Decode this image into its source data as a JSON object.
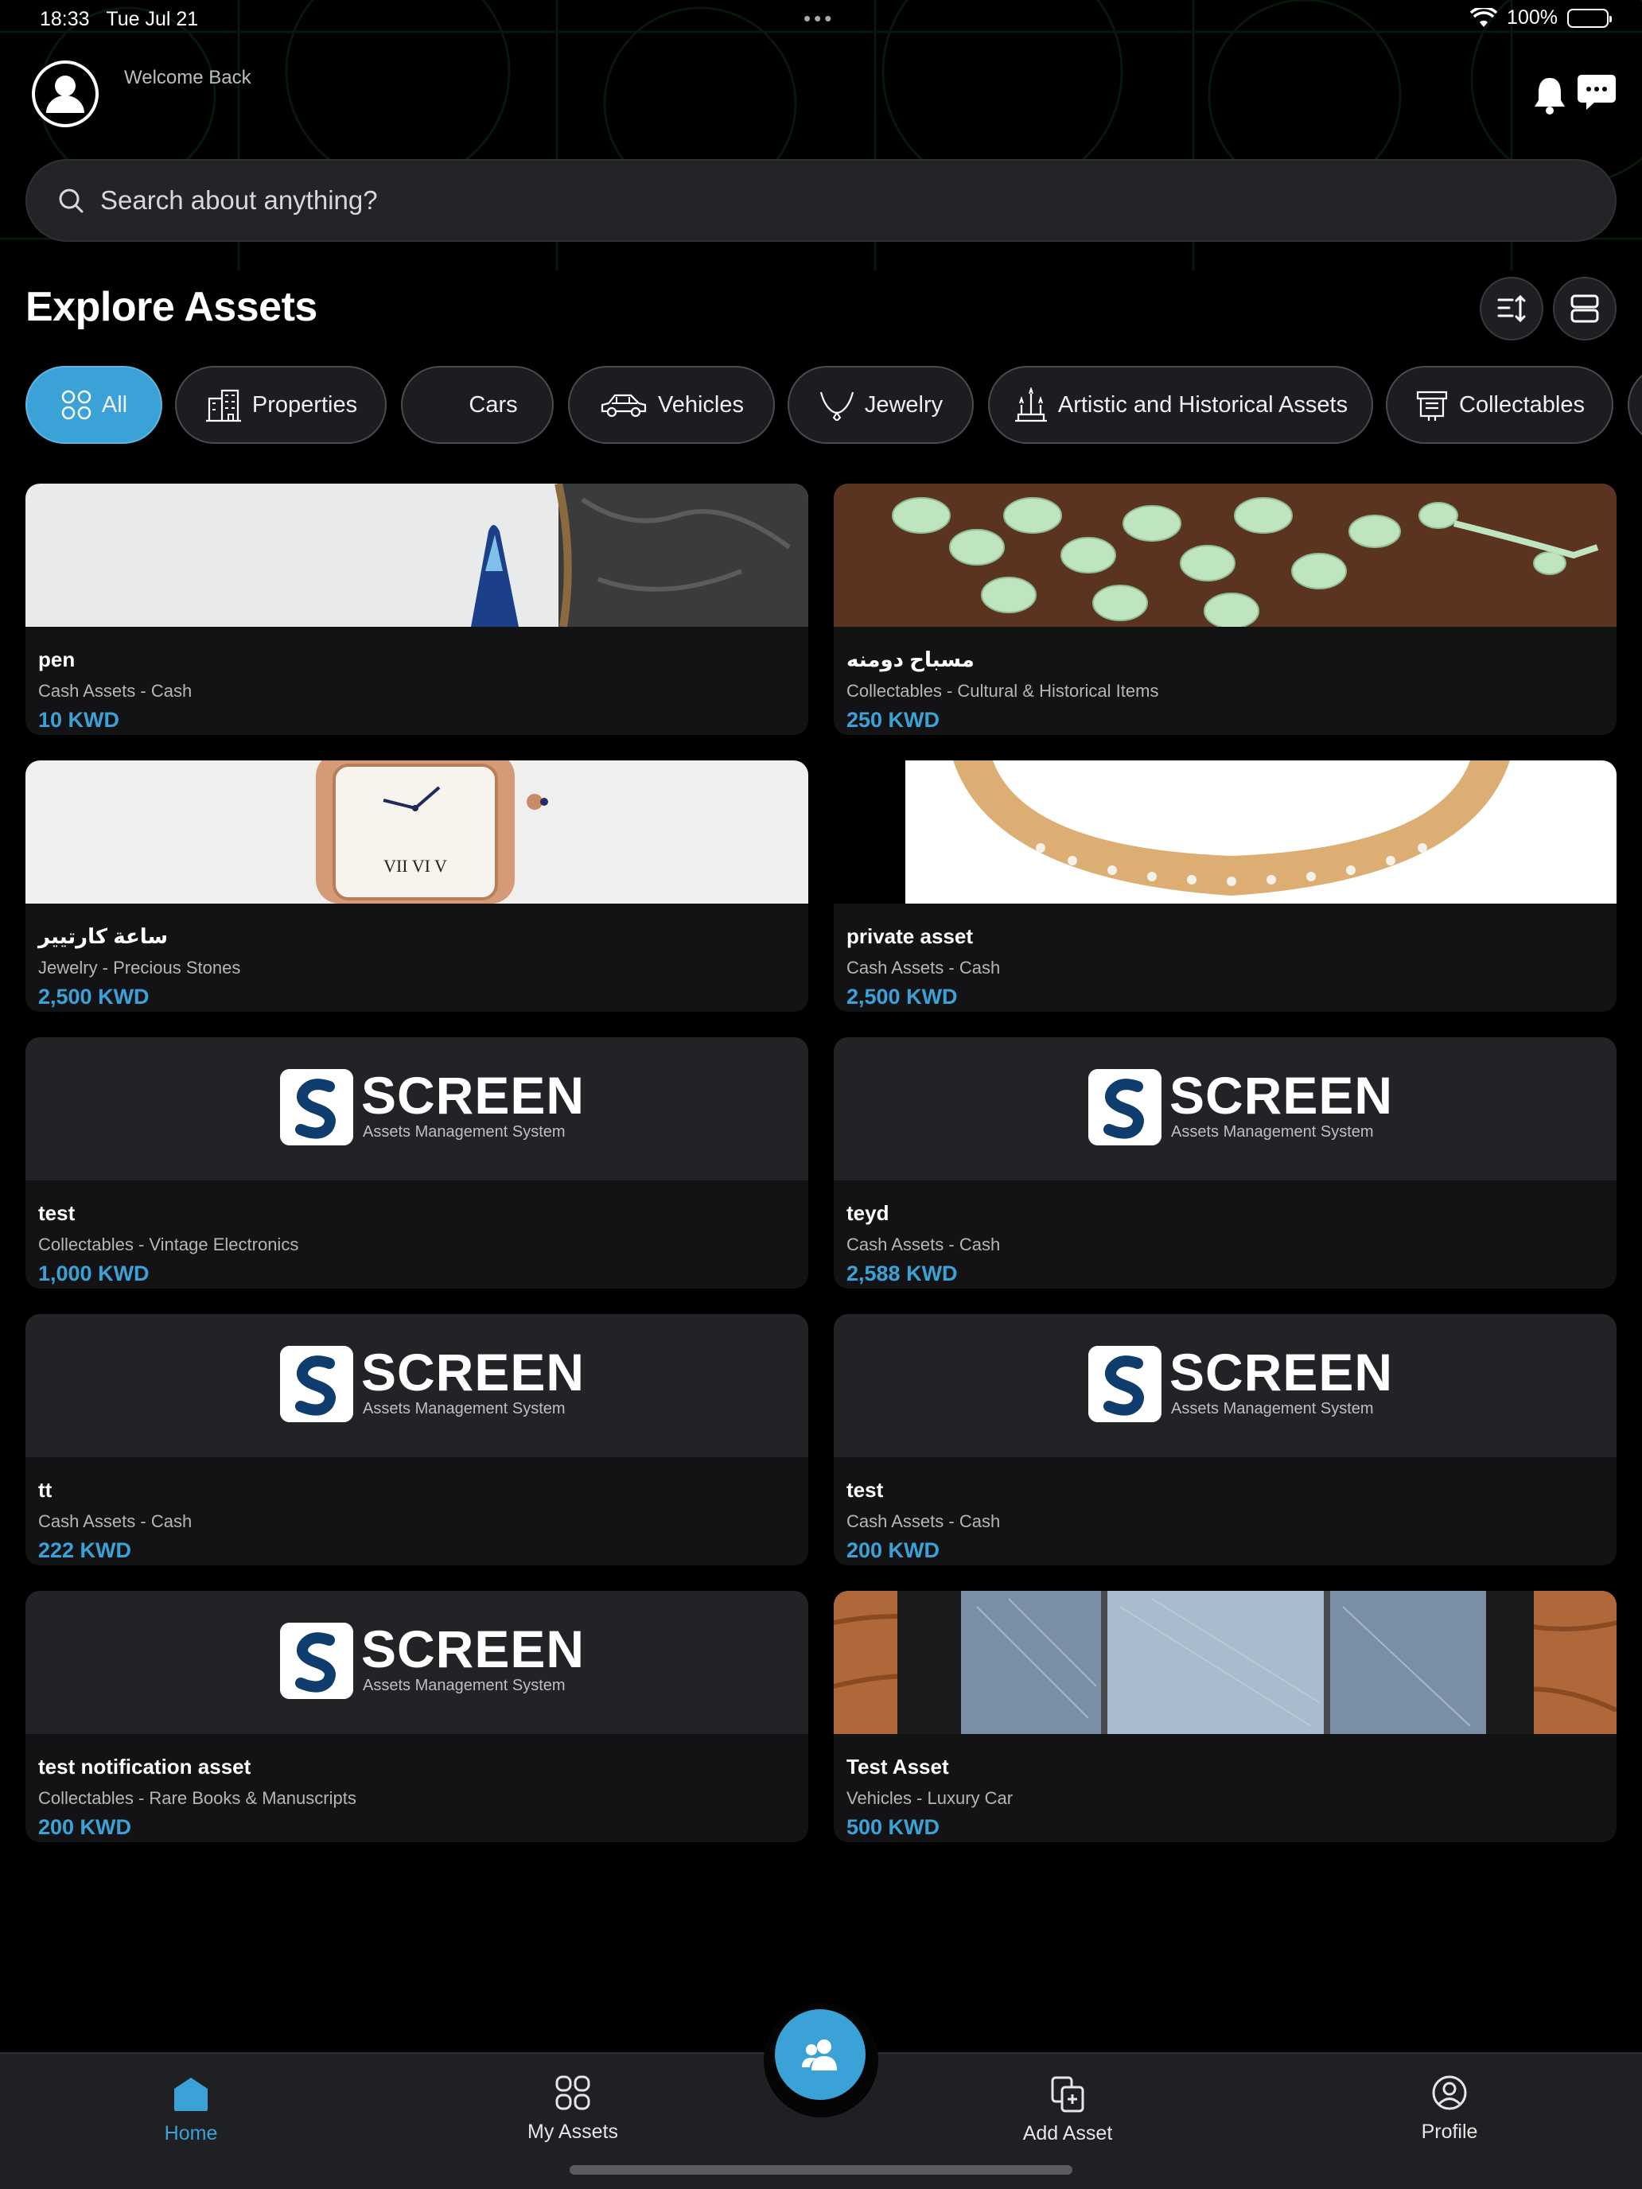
{
  "status_bar": {
    "time": "18:33",
    "date": "Tue Jul 21",
    "battery": "100%"
  },
  "header": {
    "welcome": "Welcome Back"
  },
  "search": {
    "placeholder": "Search about anything?"
  },
  "section": {
    "title": "Explore Assets"
  },
  "categories": [
    {
      "label": "All",
      "icon": "grid-icon",
      "active": true
    },
    {
      "label": "Properties",
      "icon": "building-icon"
    },
    {
      "label": "Cars",
      "icon": ""
    },
    {
      "label": "Vehicles",
      "icon": "car-icon"
    },
    {
      "label": "Jewelry",
      "icon": "necklace-icon"
    },
    {
      "label": "Artistic and Historical Assets",
      "icon": "monument-icon"
    },
    {
      "label": "Collectables",
      "icon": "collectables-icon"
    }
  ],
  "logo": {
    "word": "SCREEN",
    "tagline": "Assets Management System"
  },
  "assets": [
    {
      "title": "pen",
      "category": "Cash Assets - Cash",
      "price": "10 KWD",
      "image": "pen-photo"
    },
    {
      "title": "مسباح دومنه",
      "category": "Collectables - Cultural & Historical Items",
      "price": "250 KWD",
      "image": "prayer-beads-photo"
    },
    {
      "title": "ساعة كارتيير",
      "category": "Jewelry - Precious Stones",
      "price": "2,500 KWD",
      "image": "watch-photo"
    },
    {
      "title": "private asset",
      "category": "Cash Assets - Cash",
      "price": "2,500 KWD",
      "image": "ring-photo"
    },
    {
      "title": "test",
      "category": "Collectables - Vintage Electronics",
      "price": "1,000 KWD",
      "image": "screen-logo"
    },
    {
      "title": "teyd",
      "category": "Cash Assets - Cash",
      "price": "2,588 KWD",
      "image": "screen-logo"
    },
    {
      "title": "tt",
      "category": "Cash Assets - Cash",
      "price": "222 KWD",
      "image": "screen-logo"
    },
    {
      "title": "test",
      "category": "Cash Assets - Cash",
      "price": "200 KWD",
      "image": "screen-logo"
    },
    {
      "title": "test notification asset",
      "category": "Collectables - Rare Books & Manuscripts",
      "price": "200 KWD",
      "image": "screen-logo"
    },
    {
      "title": "Test Asset",
      "category": "Vehicles - Luxury Car",
      "price": "500 KWD",
      "image": "phone-screen-photo"
    }
  ],
  "nav": {
    "home": "Home",
    "my_assets": "My Assets",
    "add_asset": "Add Asset",
    "profile": "Profile"
  },
  "colors": {
    "accent": "#3aa2d6",
    "background": "#000000",
    "card": "#131315",
    "chip": "#1c1d20"
  }
}
